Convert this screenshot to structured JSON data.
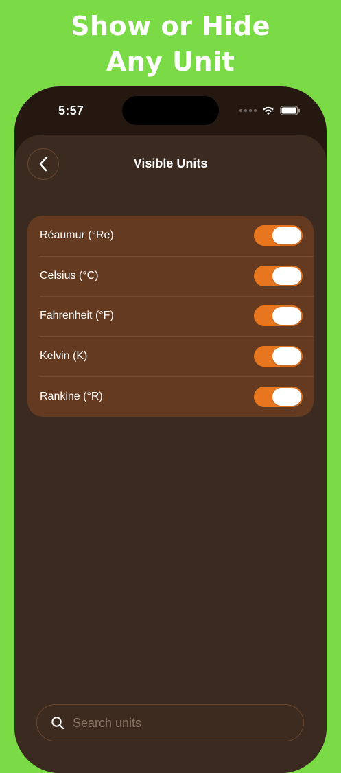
{
  "promo": {
    "line1": "Show or Hide",
    "line2": "Any Unit"
  },
  "status_bar": {
    "time": "5:57"
  },
  "header": {
    "title": "Visible Units",
    "back_icon": "chevron-left-icon"
  },
  "units": [
    {
      "label": "Réaumur (°Re)",
      "visible": true
    },
    {
      "label": "Celsius (°C)",
      "visible": true
    },
    {
      "label": "Fahrenheit (°F)",
      "visible": true
    },
    {
      "label": "Kelvin (K)",
      "visible": true
    },
    {
      "label": "Rankine (°R)",
      "visible": true
    }
  ],
  "search": {
    "placeholder": "Search units",
    "value": "",
    "icon": "search-icon"
  },
  "colors": {
    "background": "#7bdb46",
    "sheet": "#3a2a20",
    "card": "#643a20",
    "accent": "#e8761f"
  }
}
